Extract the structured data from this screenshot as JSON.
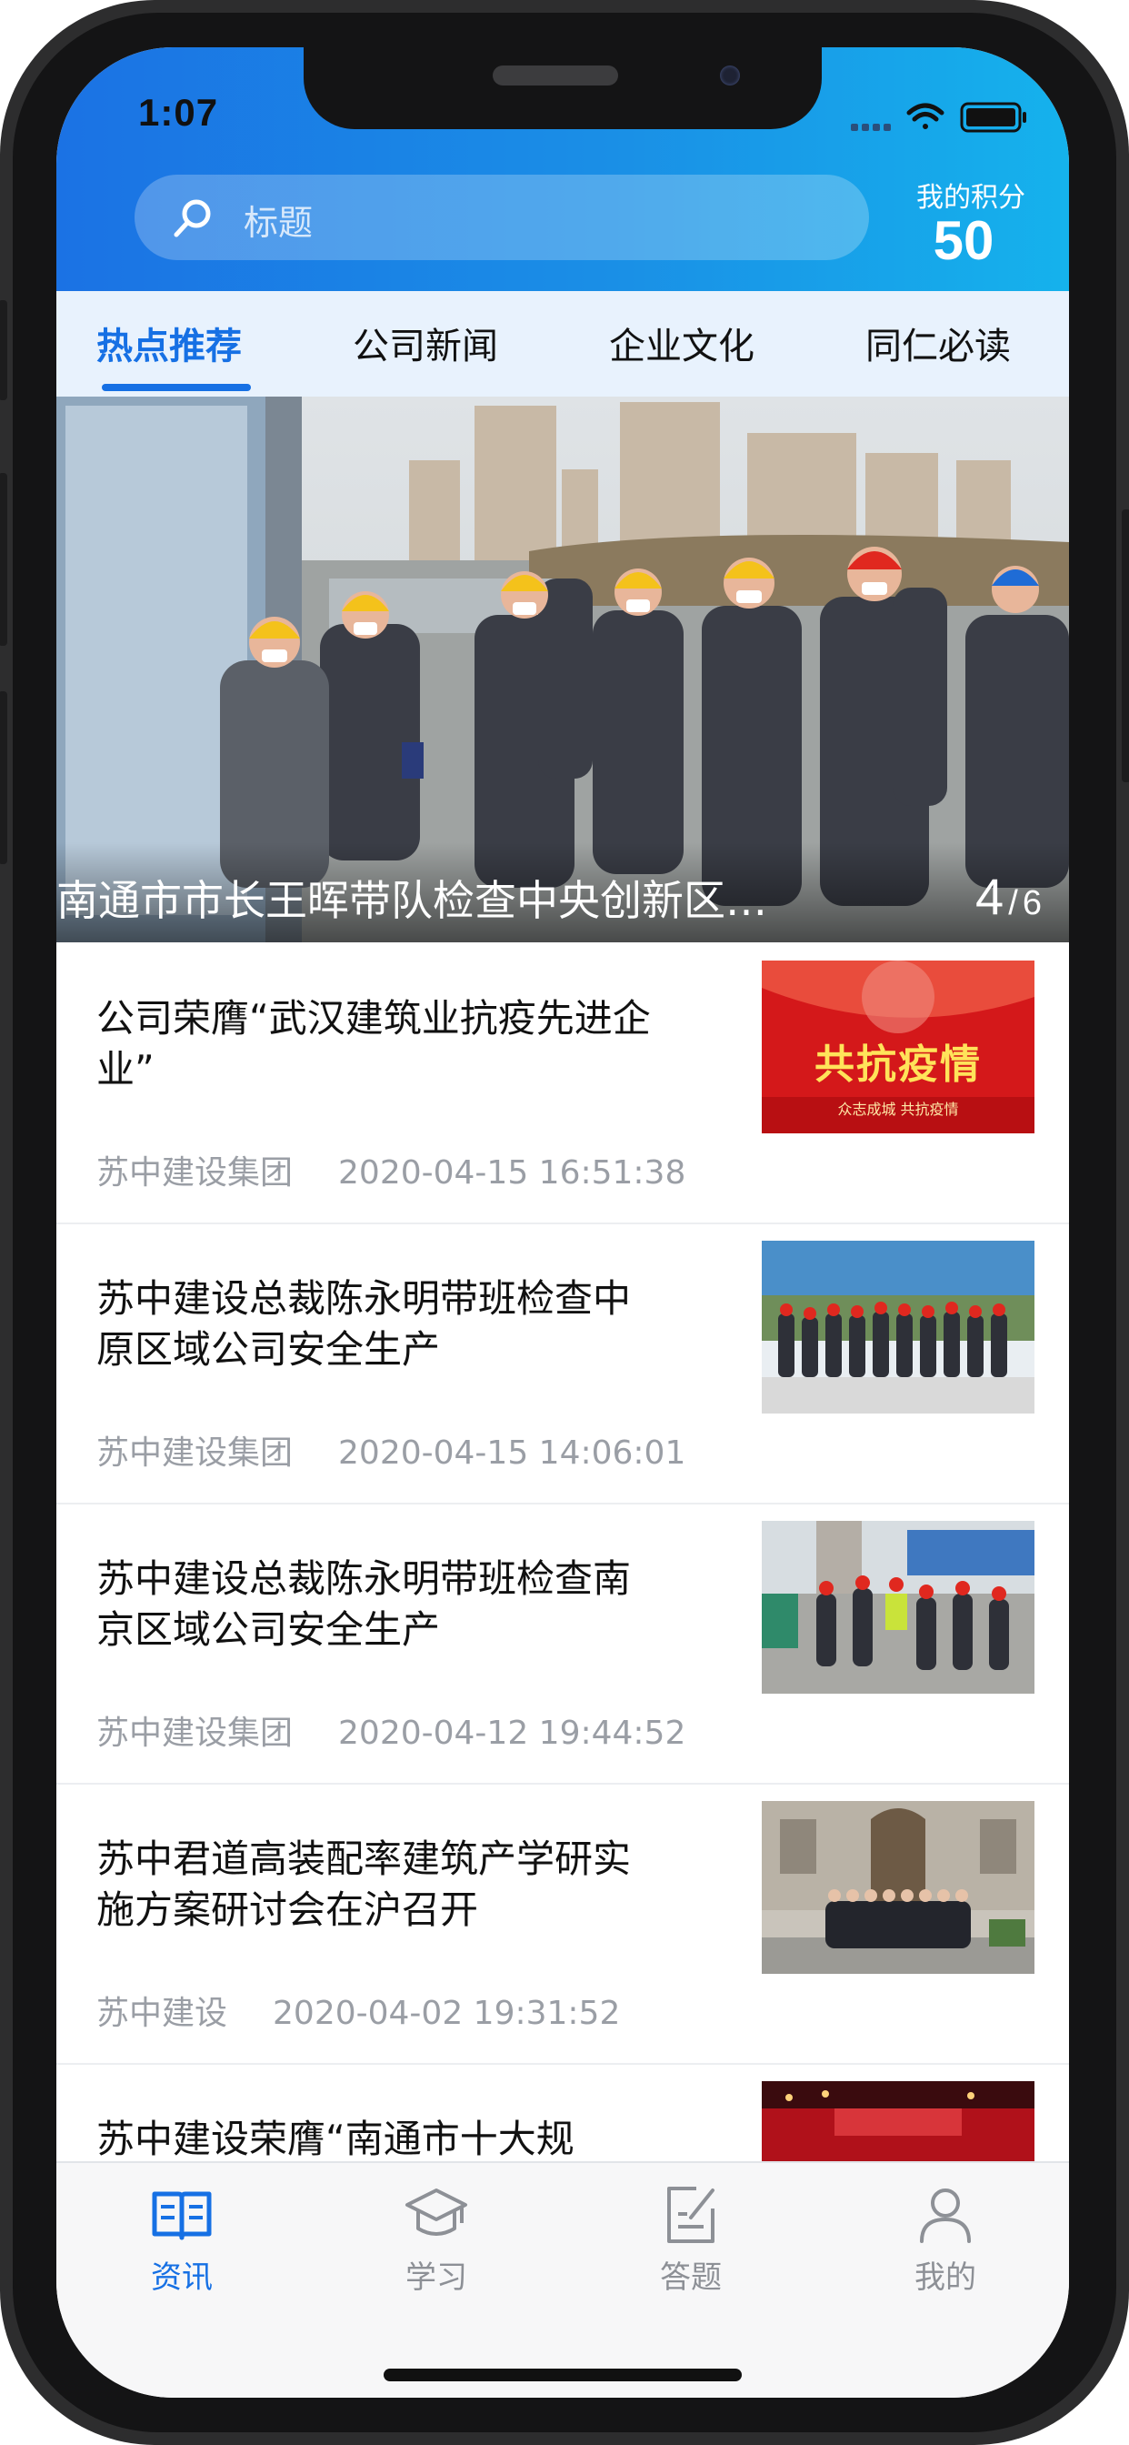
{
  "status_bar": {
    "time": "1:07"
  },
  "header": {
    "search_placeholder": "标题",
    "score_label": "我的积分",
    "score_value": "50"
  },
  "tabs": [
    {
      "label": "热点推荐",
      "active": true
    },
    {
      "label": "公司新闻",
      "active": false
    },
    {
      "label": "企业文化",
      "active": false
    },
    {
      "label": "同仁必读",
      "active": false
    }
  ],
  "banner": {
    "title": "南通市市长王晖带队检查中央创新区…",
    "current": "4",
    "separator": "/",
    "total": "6"
  },
  "news": [
    {
      "title": "公司荣膺“武汉建筑业抗疫先进企业”",
      "source": "苏中建设集团",
      "date": "2020-04-15 16:51:38",
      "thumb_text": "共抗疫情",
      "thumb_sub": "众志成城 共抗疫情"
    },
    {
      "title": "苏中建设总裁陈永明带班检查中原区域公司安全生产",
      "source": "苏中建设集团",
      "date": "2020-04-15 14:06:01"
    },
    {
      "title": "苏中建设总裁陈永明带班检查南京区域公司安全生产",
      "source": "苏中建设集团",
      "date": "2020-04-12 19:44:52"
    },
    {
      "title": "苏中君道高装配率建筑产学研实施方案研讨会在沪召开",
      "source": "苏中建设",
      "date": "2020-04-02 19:31:52"
    },
    {
      "title": "苏中建设荣膺“南通市十大规",
      "source": "",
      "date": ""
    }
  ],
  "bottom_nav": [
    {
      "label": "资讯",
      "icon": "book-icon",
      "active": true
    },
    {
      "label": "学习",
      "icon": "graduation-cap-icon",
      "active": false
    },
    {
      "label": "答题",
      "icon": "edit-note-icon",
      "active": false
    },
    {
      "label": "我的",
      "icon": "person-icon",
      "active": false
    }
  ],
  "colors": {
    "accent": "#1670e4",
    "header_start": "#1b72e4",
    "header_end": "#15b2ec",
    "tab_bar": "#e8f2fd",
    "meta_text": "#9a9ea5"
  }
}
